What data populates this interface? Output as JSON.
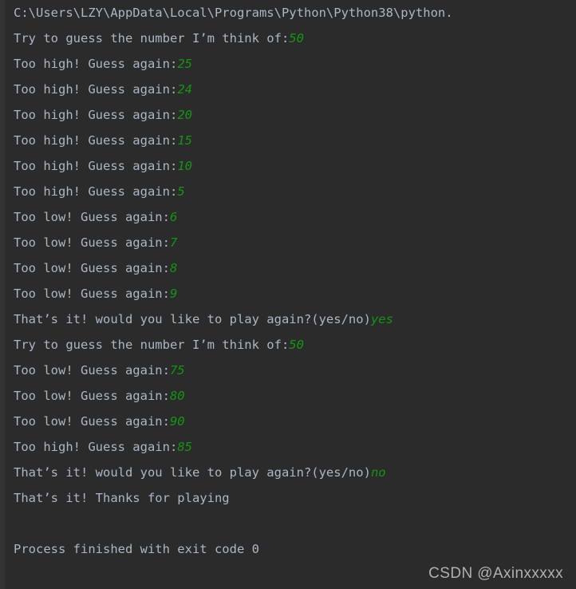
{
  "console": {
    "background_color": "#2b2b2b",
    "gutter_color": "#313335",
    "output_text_color": "#a9b7c6",
    "input_text_color": "#149414",
    "lines": [
      {
        "id": "interpreter-path",
        "out": "C:\\Users\\LZY\\AppData\\Local\\Programs\\Python\\Python38\\python.",
        "inp": ""
      },
      {
        "id": "prompt-guess-1",
        "out": "Try to guess the number I’m think of:",
        "inp": "50"
      },
      {
        "id": "too-high-1",
        "out": "Too high! Guess again:",
        "inp": "25"
      },
      {
        "id": "too-high-2",
        "out": "Too high! Guess again:",
        "inp": "24"
      },
      {
        "id": "too-high-3",
        "out": "Too high! Guess again:",
        "inp": "20"
      },
      {
        "id": "too-high-4",
        "out": "Too high! Guess again:",
        "inp": "15"
      },
      {
        "id": "too-high-5",
        "out": "Too high! Guess again:",
        "inp": "10"
      },
      {
        "id": "too-high-6",
        "out": "Too high! Guess again:",
        "inp": "5"
      },
      {
        "id": "too-low-1",
        "out": "Too low! Guess again:",
        "inp": "6"
      },
      {
        "id": "too-low-2",
        "out": "Too low! Guess again:",
        "inp": "7"
      },
      {
        "id": "too-low-3",
        "out": "Too low! Guess again:",
        "inp": "8"
      },
      {
        "id": "too-low-4",
        "out": "Too low! Guess again:",
        "inp": "9"
      },
      {
        "id": "play-again-prompt-1",
        "out": "That’s it! would you like to play again?(yes/no)",
        "inp": "yes"
      },
      {
        "id": "prompt-guess-2",
        "out": "Try to guess the number I’m think of:",
        "inp": "50"
      },
      {
        "id": "too-low-5",
        "out": "Too low! Guess again:",
        "inp": "75"
      },
      {
        "id": "too-low-6",
        "out": "Too low! Guess again:",
        "inp": "80"
      },
      {
        "id": "too-low-7",
        "out": "Too low! Guess again:",
        "inp": "90"
      },
      {
        "id": "too-high-7",
        "out": "Too high! Guess again:",
        "inp": "85"
      },
      {
        "id": "play-again-prompt-2",
        "out": "That’s it! would you like to play again?(yes/no)",
        "inp": "no"
      },
      {
        "id": "thanks-for-playing",
        "out": "That’s it! Thanks for playing",
        "inp": ""
      },
      {
        "id": "blank-1",
        "out": "",
        "inp": ""
      },
      {
        "id": "process-finished",
        "out": "Process finished with exit code 0",
        "inp": ""
      }
    ]
  },
  "watermark": {
    "text": "CSDN @Axinxxxxx"
  }
}
